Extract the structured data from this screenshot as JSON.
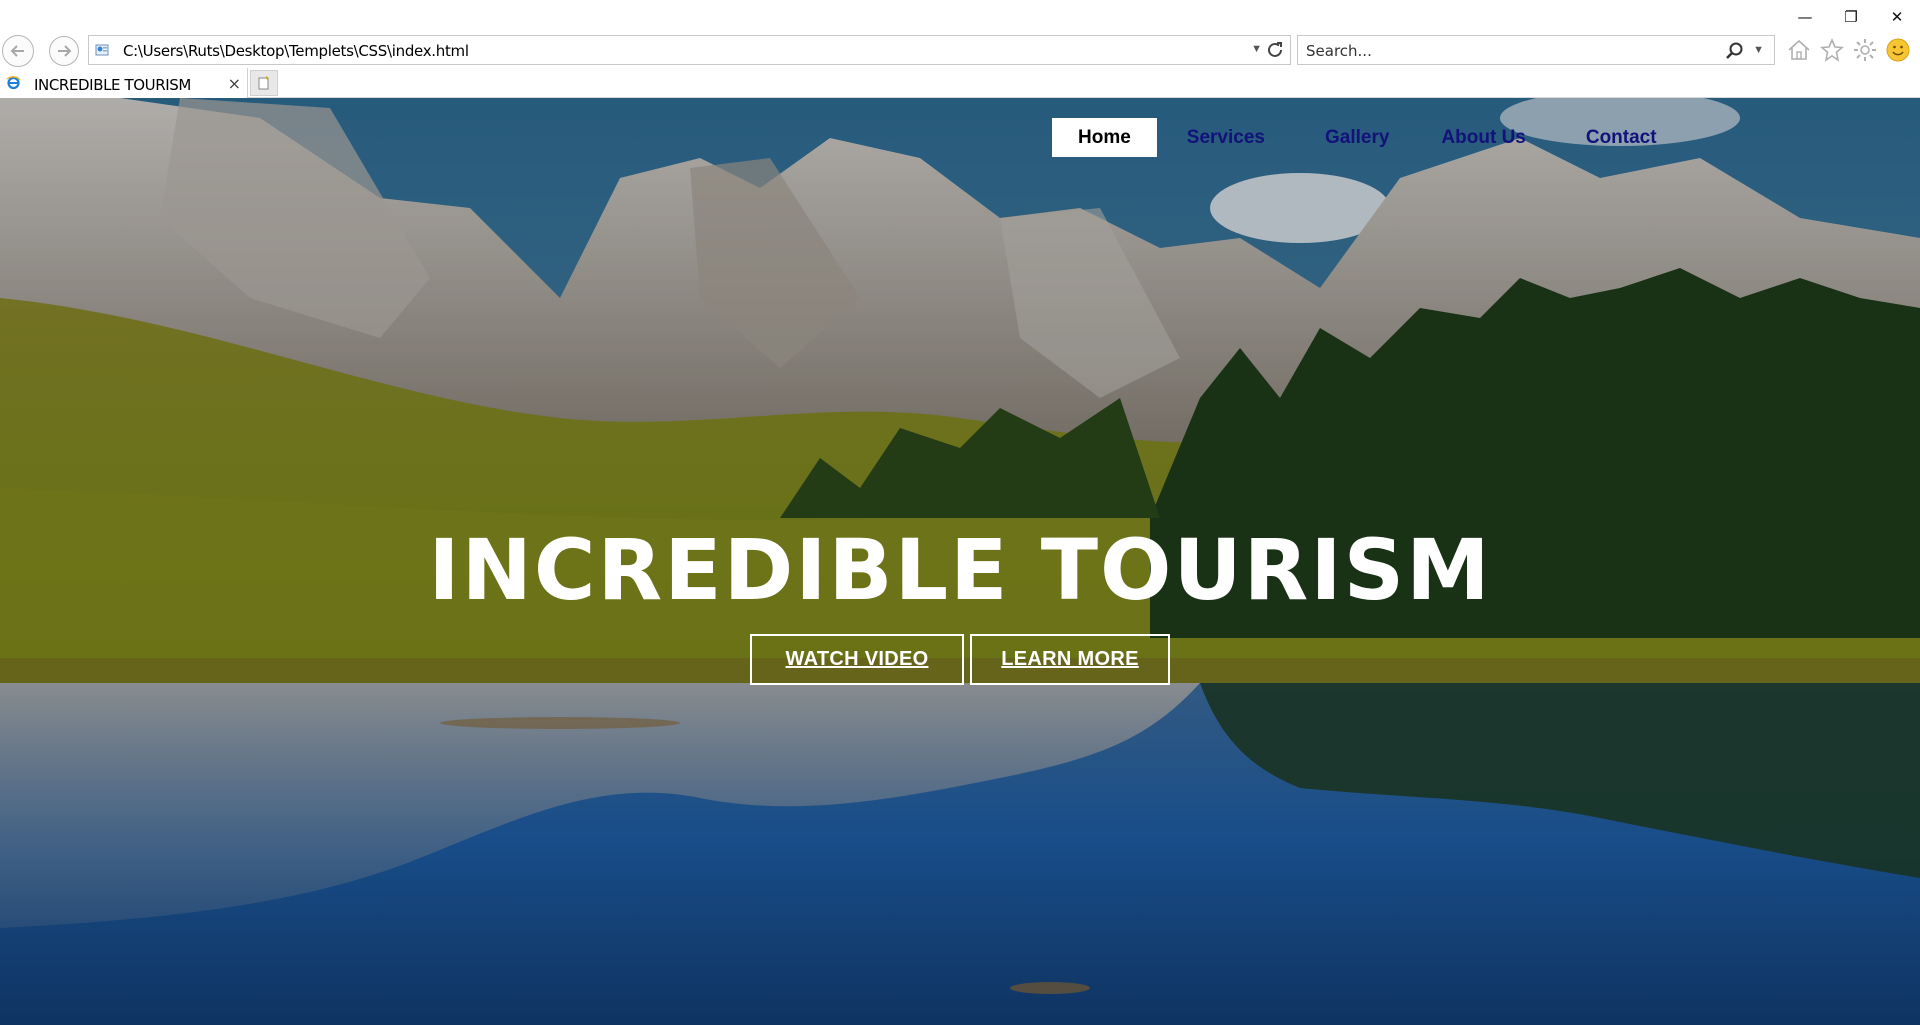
{
  "browser": {
    "address": "C:\\Users\\Ruts\\Desktop\\Templets\\CSS\\index.html",
    "search_placeholder": "Search...",
    "tab_title": "INCREDIBLE TOURISM",
    "window_controls": {
      "minimize": "—",
      "restore": "❐",
      "close": "✕"
    },
    "tab_close": "×"
  },
  "site": {
    "nav": [
      {
        "label": "Home",
        "active": true
      },
      {
        "label": "Services"
      },
      {
        "label": "Gallery"
      },
      {
        "label": "About Us"
      },
      {
        "label": "Contact"
      }
    ],
    "hero": {
      "title": "INCREDIBLE TOURISM",
      "buttons": {
        "watch": "WATCH VIDEO",
        "learn": "LEARN MORE"
      }
    }
  },
  "colors": {
    "nav_link": "#12127a",
    "nav_active_bg": "#ffffff",
    "hero_text": "#ffffff"
  }
}
